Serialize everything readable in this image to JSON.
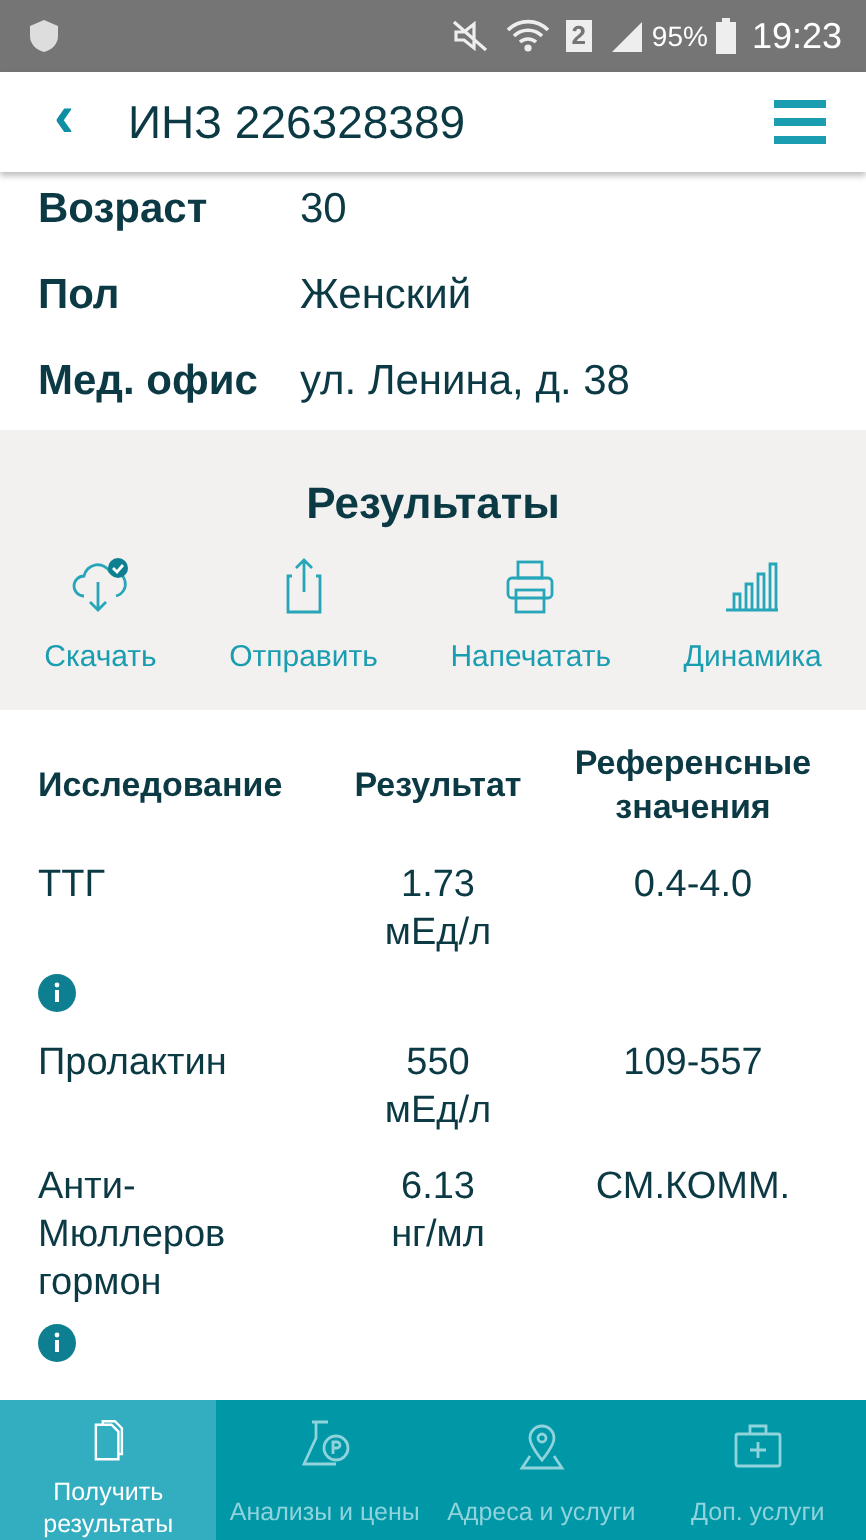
{
  "status_bar": {
    "sim": "2",
    "battery": "95%",
    "time": "19:23"
  },
  "header": {
    "back": "‹",
    "title": "ИНЗ 226328389"
  },
  "patient": [
    {
      "label": "Возраст",
      "value": "30"
    },
    {
      "label": "Пол",
      "value": "Женский"
    },
    {
      "label": "Мед. офис",
      "value": "ул. Ленина, д. 38"
    }
  ],
  "results": {
    "title": "Результаты",
    "actions": [
      {
        "label": "Скачать"
      },
      {
        "label": "Отправить"
      },
      {
        "label": "Напечатать"
      },
      {
        "label": "Динамика"
      }
    ]
  },
  "table": {
    "columns": [
      "Исследование",
      "Результат",
      "Референсные значения"
    ],
    "rows": [
      {
        "test": "ТТГ",
        "result": "1.73 мЕд/л",
        "reference": "0.4-4.0",
        "has_info": true
      },
      {
        "test": "Пролактин",
        "result": "550 мЕд/л",
        "reference": "109-557",
        "has_info": false
      },
      {
        "test": "Анти-Мюллеров гормон",
        "result": "6.13 нг/мл",
        "reference": "СМ.КОММ.",
        "has_info": true
      }
    ]
  },
  "bottom_nav": [
    {
      "label": "Получить результаты",
      "selected": true
    },
    {
      "label": "Анализы и цены",
      "selected": false
    },
    {
      "label": "Адреса и услуги",
      "selected": false
    },
    {
      "label": "Доп. услуги",
      "selected": false
    }
  ]
}
